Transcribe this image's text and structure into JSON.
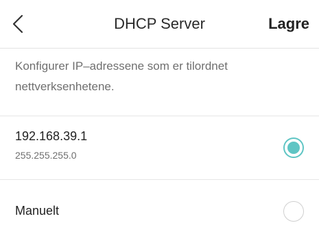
{
  "header": {
    "title": "DHCP Server",
    "save_label": "Lagre",
    "back_icon": "chevron-left-icon"
  },
  "description": "Konfigurer IP–adressene som er tilordnet nettverksenhetene.",
  "options": [
    {
      "ip": "192.168.39.1",
      "mask": "255.255.255.0",
      "selected": true
    },
    {
      "label": "Manuelt",
      "selected": false
    }
  ],
  "colors": {
    "accent": "#5fc5c4",
    "radio_unselected_border": "#cfcfcf",
    "secondary_text": "#6f6f6f",
    "divider": "#e6e6e6"
  }
}
